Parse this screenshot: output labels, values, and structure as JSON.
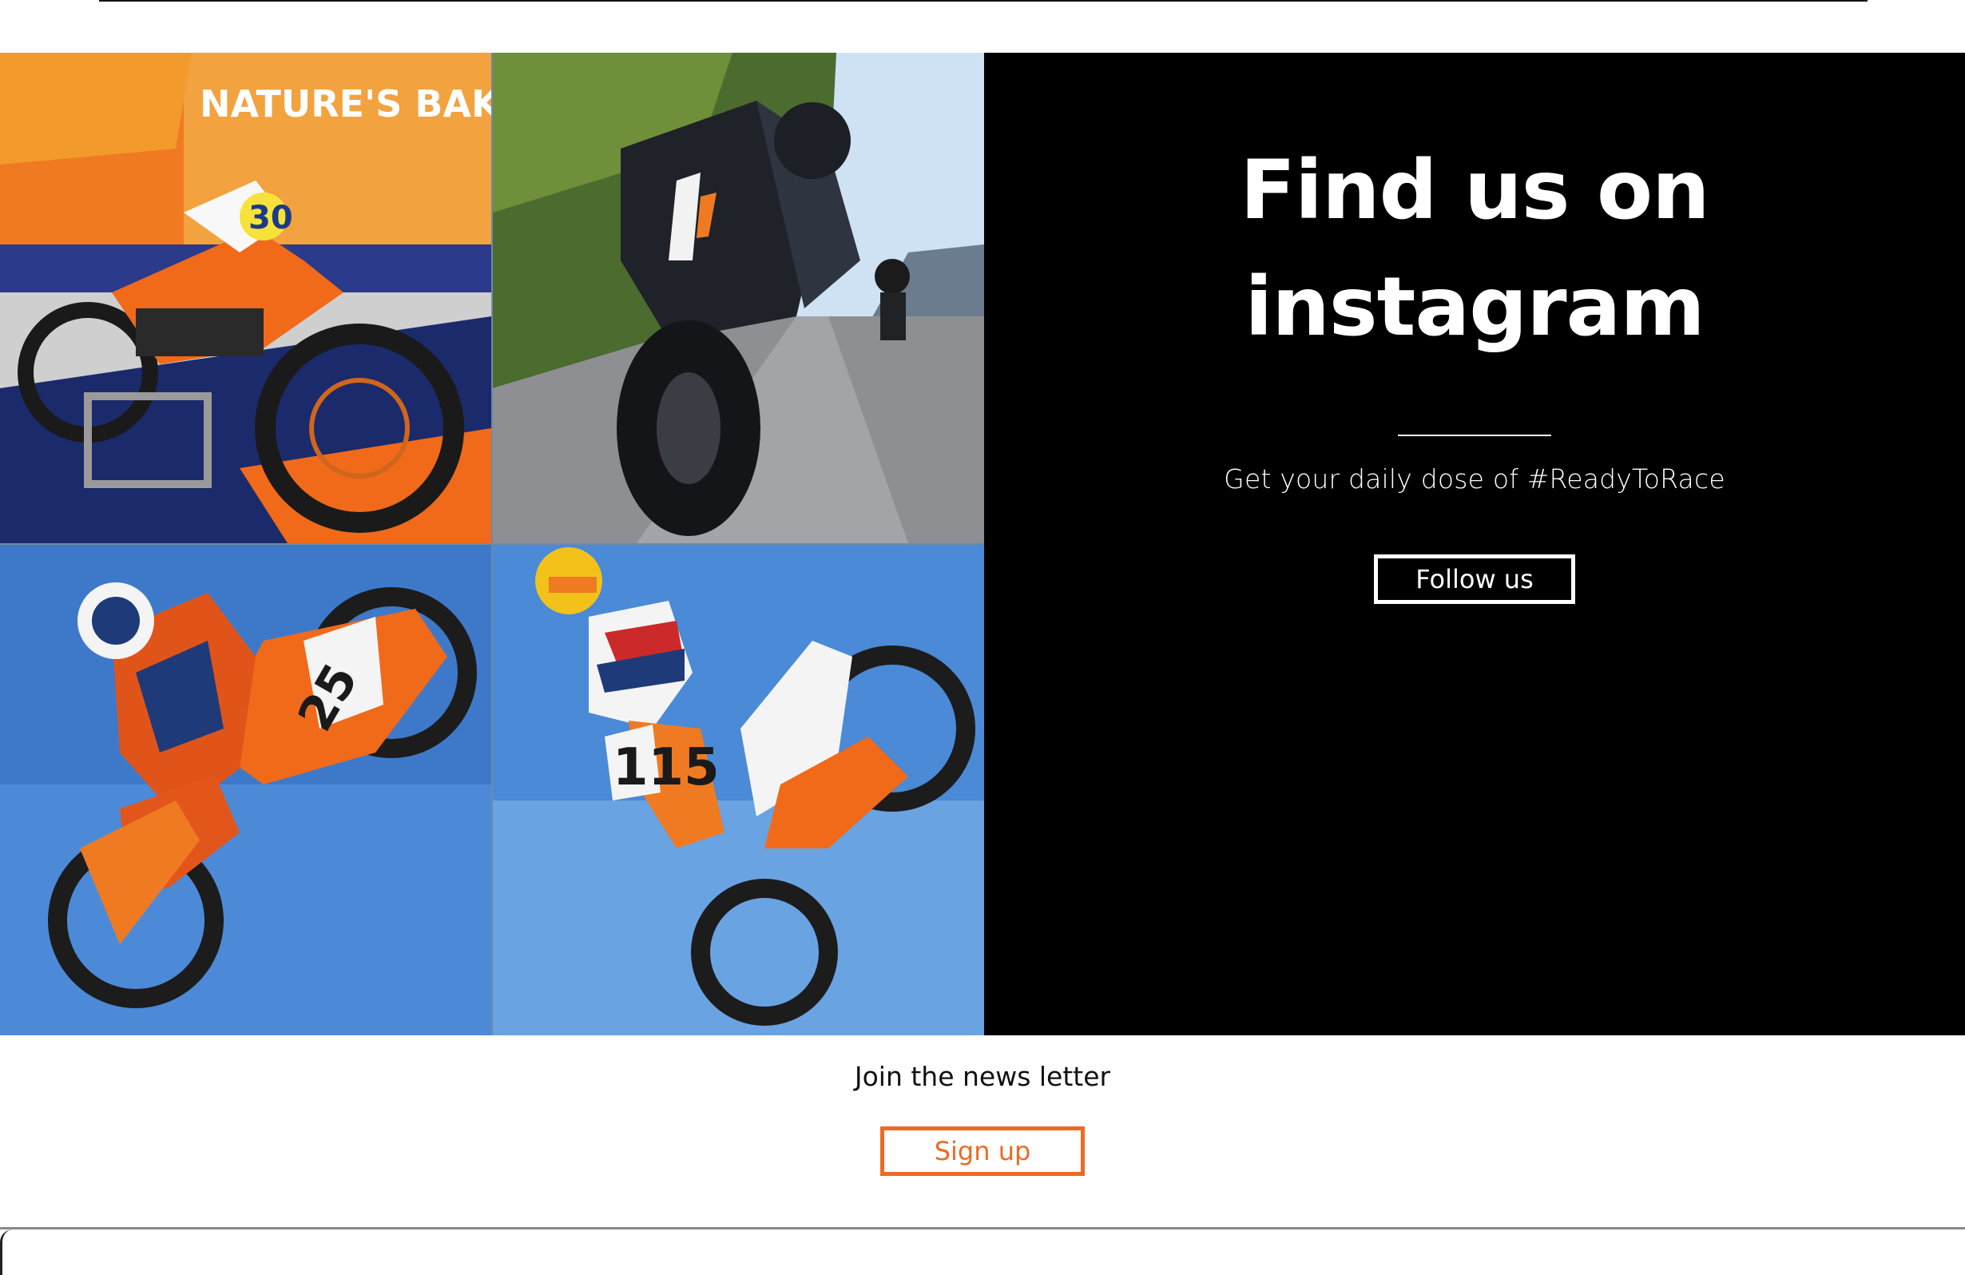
{
  "instagram": {
    "title_line1": "Find us on",
    "title_line2": "instagram",
    "tagline": "Get your daily dose of #ReadyToRace",
    "follow_label": "Follow us"
  },
  "photos": [
    {
      "name": "photo-motocross-bike-on-stand",
      "banner_text": "NATURE'S BAKERY",
      "number": "30"
    },
    {
      "name": "photo-adventure-bike-riding",
      "banner_text": "",
      "number": ""
    },
    {
      "name": "photo-rider-jump-25",
      "banner_text": "",
      "number": "25"
    },
    {
      "name": "photo-rider-jump-115",
      "banner_text": "",
      "number": "115"
    }
  ],
  "newsletter": {
    "label": "Join the news letter",
    "signup_label": "Sign up"
  },
  "colors": {
    "accent": "#ee6a22",
    "panel_bg": "#000000",
    "sky": "#4a8ad6"
  }
}
